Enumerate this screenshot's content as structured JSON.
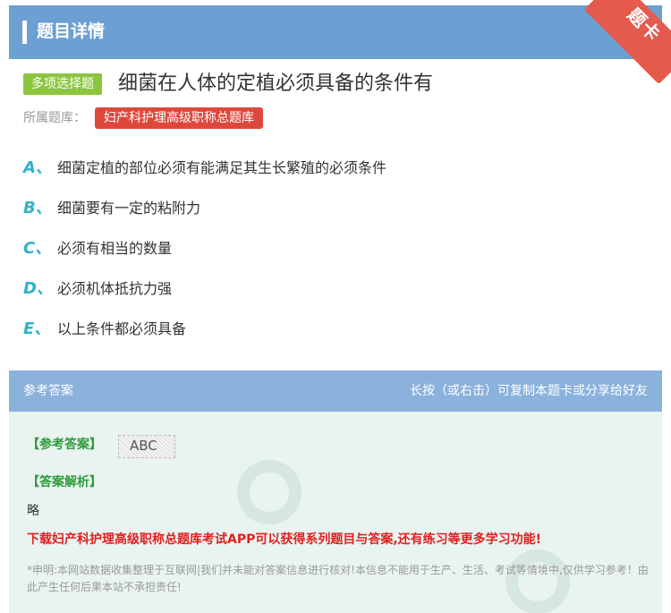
{
  "header": {
    "title": "题目详情",
    "corner_label": "题卡"
  },
  "question": {
    "type_badge": "多项选择题",
    "title": "细菌在人体的定植必须具备的条件有",
    "bank_label": "所属题库：",
    "bank_name": "妇产科护理高级职称总题库"
  },
  "options": [
    {
      "letter": "A、",
      "text": "细菌定植的部位必须有能满足其生长繁殖的必须条件"
    },
    {
      "letter": "B、",
      "text": "细菌要有一定的粘附力"
    },
    {
      "letter": "C、",
      "text": "必须有相当的数量"
    },
    {
      "letter": "D、",
      "text": "必须机体抵抗力强"
    },
    {
      "letter": "E、",
      "text": "以上条件都必须具备"
    }
  ],
  "answer_panel": {
    "title": "参考答案",
    "hint": "长按（或右击）可复制本题卡或分享给好友",
    "answer_label": "【参考答案】",
    "answer_value": "ABC",
    "analysis_label": "【答案解析】",
    "analysis_text": "略",
    "promo": "下载妇产科护理高级职称总题库考试APP可以获得系列题目与答案,还有练习等更多学习功能!",
    "disclaimer": "*申明:本网站数据收集整理于互联网|我们并未能对答案信息进行核对!本信息不能用于生产、生活、考试等情境中,仅供学习参考！由此产生任何后果本站不承担责任!"
  }
}
